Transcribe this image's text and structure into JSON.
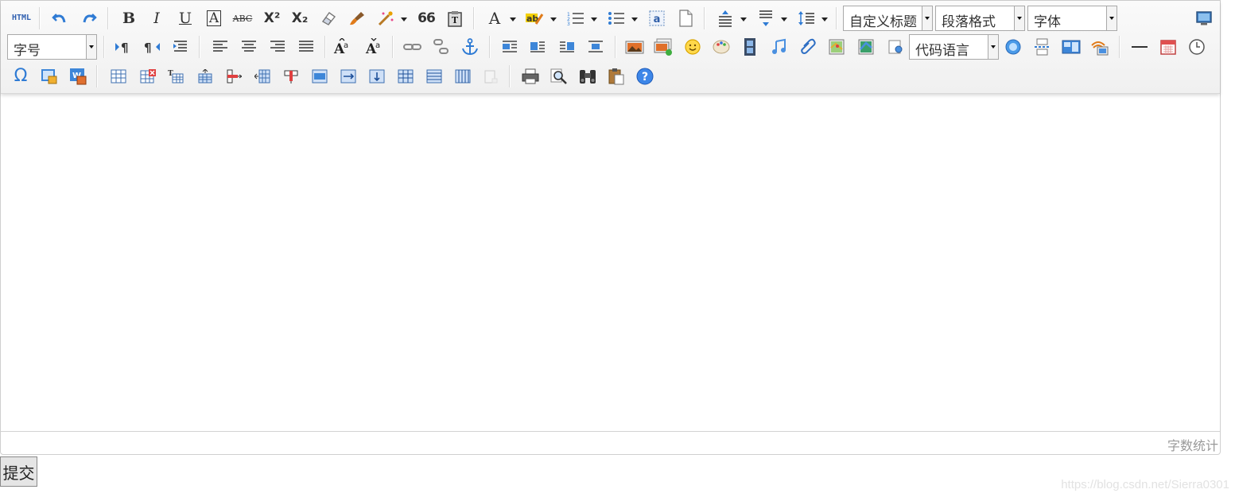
{
  "toolbar": {
    "row1": {
      "html_label": "HTML",
      "bold": "B",
      "italic": "I",
      "underline": "U",
      "fontborder": "A",
      "strikethrough": "ABC",
      "superscript": "X²",
      "subscript": "X₂",
      "blockquote": "66",
      "forecolor": "A",
      "custom_title": "自定义标题",
      "paragraph_format": "段落格式",
      "font_family": "字体"
    },
    "row2": {
      "font_size": "字号",
      "code_language": "代码语言"
    }
  },
  "editor": {
    "word_count_label": "字数统计"
  },
  "form": {
    "submit_label": "提交"
  },
  "watermark": "https://blog.csdn.net/Sierra0301",
  "colors": {
    "accent_blue": "#2f7bd4",
    "icon_orange": "#e07b1a",
    "border": "#cfcfcf"
  }
}
